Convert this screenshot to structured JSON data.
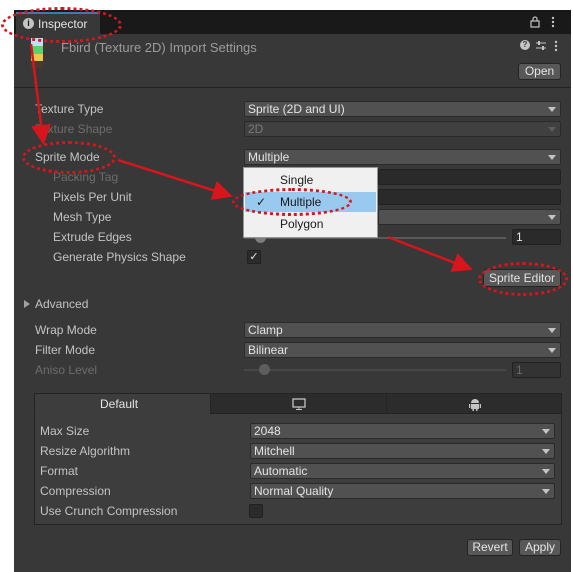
{
  "tab": {
    "title": "Inspector",
    "icon": "info-icon"
  },
  "header": {
    "title": "Fbird (Texture 2D) Import Settings",
    "open_label": "Open",
    "icons": [
      "lock-icon",
      "kebab-menu-icon",
      "help-icon",
      "presets-icon",
      "more-icon"
    ]
  },
  "fields": {
    "texture_type": {
      "label": "Texture Type",
      "value": "Sprite (2D and UI)"
    },
    "texture_shape": {
      "label": "Texture Shape",
      "value": "2D"
    },
    "sprite_mode": {
      "label": "Sprite Mode",
      "value": "Multiple"
    },
    "packing_tag": {
      "label": "Packing Tag"
    },
    "pixels_per_unit": {
      "label": "Pixels Per Unit"
    },
    "mesh_type": {
      "label": "Mesh Type"
    },
    "extrude_edges": {
      "label": "Extrude Edges",
      "value": "1"
    },
    "generate_physics_shape": {
      "label": "Generate Physics Shape",
      "checked": true
    }
  },
  "sprite_editor_label": "Sprite Editor",
  "popup": {
    "options": [
      {
        "label": "Single",
        "selected": false
      },
      {
        "label": "Multiple",
        "selected": true
      },
      {
        "label": "Polygon",
        "selected": false
      }
    ]
  },
  "advanced_label": "Advanced",
  "wrap_filter": {
    "wrap_mode": {
      "label": "Wrap Mode",
      "value": "Clamp"
    },
    "filter_mode": {
      "label": "Filter Mode",
      "value": "Bilinear"
    },
    "aniso_level": {
      "label": "Aniso Level",
      "value": "1"
    }
  },
  "platform": {
    "tabs": [
      {
        "label": "Default",
        "icon": "",
        "active": true
      },
      {
        "label": "",
        "icon": "monitor-icon",
        "active": false
      },
      {
        "label": "",
        "icon": "android-icon",
        "active": false
      }
    ],
    "max_size": {
      "label": "Max Size",
      "value": "2048"
    },
    "resize_algorithm": {
      "label": "Resize Algorithm",
      "value": "Mitchell"
    },
    "format": {
      "label": "Format",
      "value": "Automatic"
    },
    "compression": {
      "label": "Compression",
      "value": "Normal Quality"
    },
    "use_crunch": {
      "label": "Use Crunch Compression",
      "checked": false
    }
  },
  "footer": {
    "revert_label": "Revert",
    "apply_label": "Apply"
  },
  "colors": {
    "panel": "#383838",
    "field": "#515151",
    "selection": "#99c9ef",
    "annotation": "#d8151c",
    "tab_accent": "#3a79bb"
  }
}
